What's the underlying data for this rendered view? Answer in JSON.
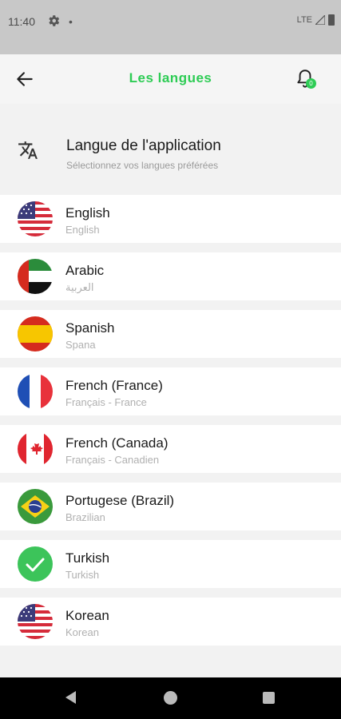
{
  "status": {
    "time": "11:40",
    "network": "LTE"
  },
  "app_bar": {
    "title": "Les langues",
    "badge_count": "0"
  },
  "section": {
    "title": "Langue de l'application",
    "subtitle": "Sélectionnez vos langues préférées"
  },
  "languages": [
    {
      "name": "English",
      "native": "English",
      "flag": "us-flag-icon"
    },
    {
      "name": "Arabic",
      "native": "العربية",
      "flag": "uae-flag-icon"
    },
    {
      "name": "Spanish",
      "native": "Spana",
      "flag": "spain-flag-icon"
    },
    {
      "name": "French (France)",
      "native": "Français - France",
      "flag": "france-flag-icon"
    },
    {
      "name": "French (Canada)",
      "native": "Français - Canadien",
      "flag": "canada-flag-icon"
    },
    {
      "name": "Portugese (Brazil)",
      "native": "Brazilian",
      "flag": "brazil-flag-icon"
    },
    {
      "name": "Turkish",
      "native": "Turkish",
      "flag": "selected-check-icon",
      "selected": true
    },
    {
      "name": "Korean",
      "native": "Korean",
      "flag": "us-flag-icon"
    }
  ],
  "colors": {
    "accent": "#2ecc55",
    "background": "#f2f2f2",
    "card": "#ffffff"
  }
}
